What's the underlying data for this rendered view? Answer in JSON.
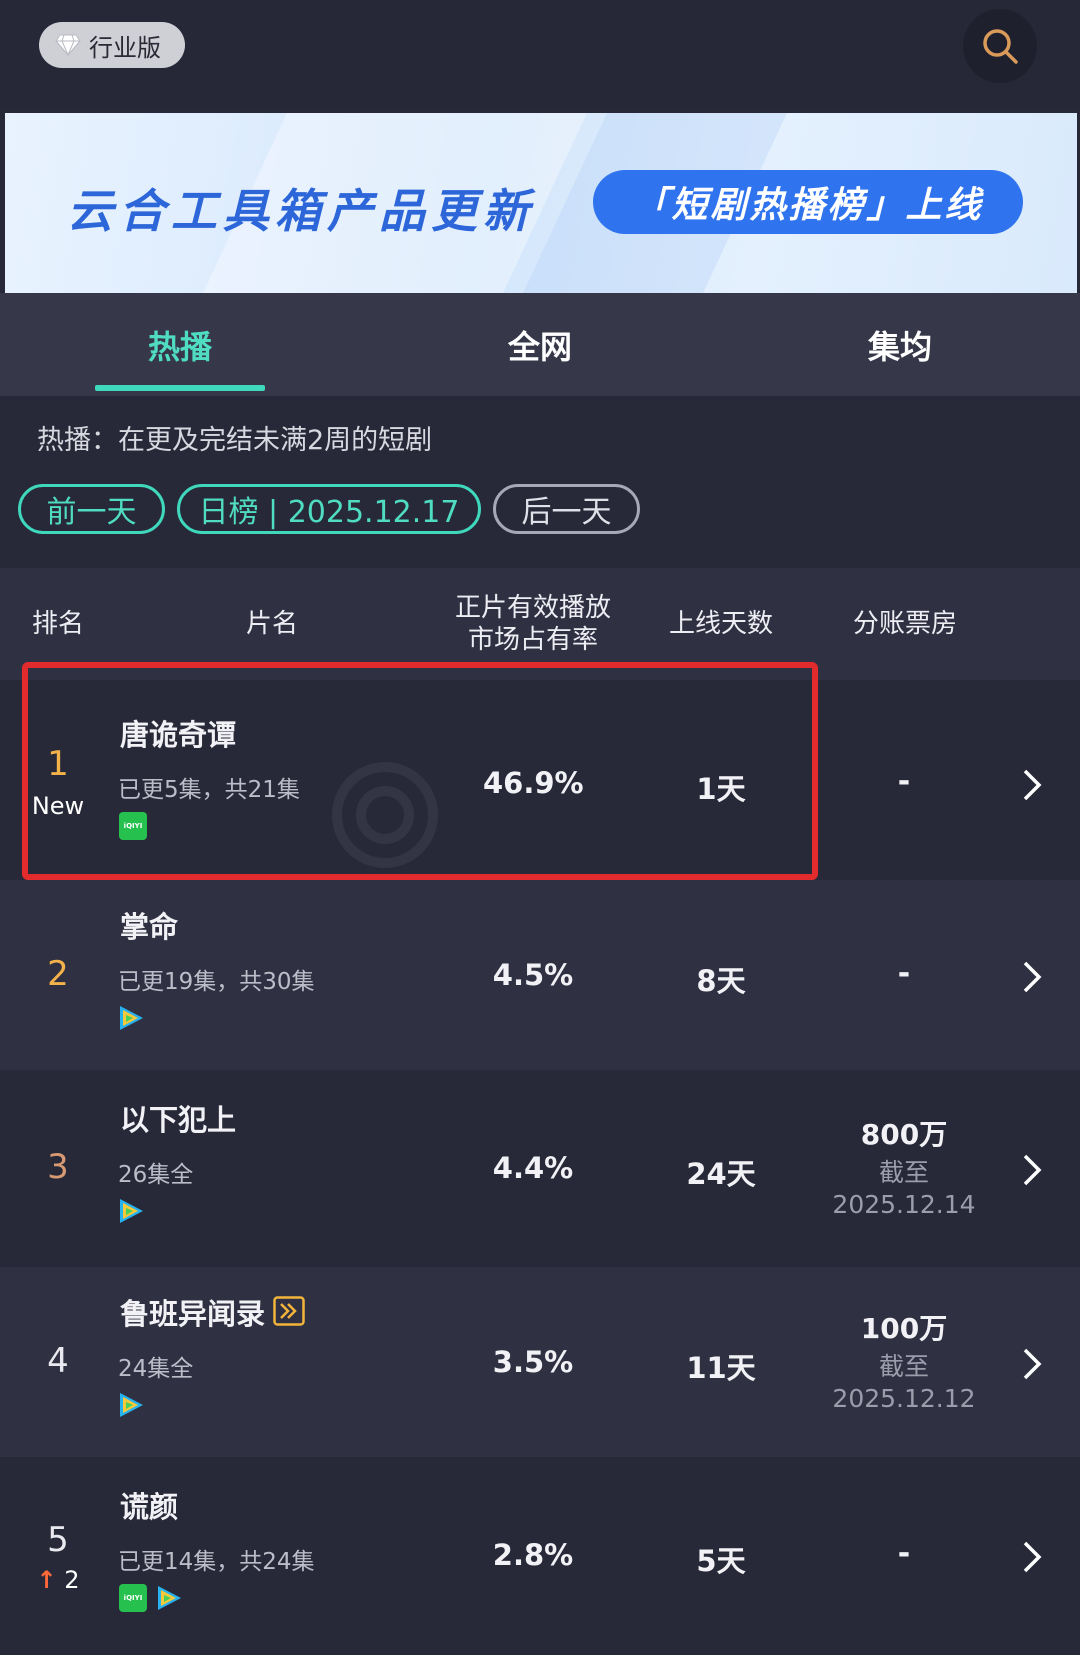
{
  "header": {
    "badge_label": "行业版",
    "search_icon": "search-icon"
  },
  "banner": {
    "title": "云合工具箱产品更新",
    "pill": "「短剧热播榜」上线"
  },
  "tabs": [
    {
      "label": "热播",
      "active": true
    },
    {
      "label": "全网",
      "active": false
    },
    {
      "label": "集均",
      "active": false
    }
  ],
  "description": "热播：在更及完结未满2周的短剧",
  "date_nav": {
    "prev": "前一天",
    "current": "日榜 | 2025.12.17",
    "next": "后一天"
  },
  "table": {
    "headers": {
      "rank": "排名",
      "title": "片名",
      "share_line1": "正片有效播放",
      "share_line2": "市场占有率",
      "days": "上线天数",
      "box": "分账票房"
    },
    "rows": [
      {
        "rank": "1",
        "rank_sub": "New",
        "title": "唐诡奇谭",
        "episodes": "已更5集，共21集",
        "platforms": [
          "iqiyi"
        ],
        "share": "46.9%",
        "days": "1天",
        "box": "-",
        "box_note": "",
        "box_date": "",
        "highlighted": true
      },
      {
        "rank": "2",
        "rank_sub": "",
        "title": "掌命",
        "episodes": "已更19集，共30集",
        "platforms": [
          "tencent"
        ],
        "share": "4.5%",
        "days": "8天",
        "box": "-",
        "box_note": "",
        "box_date": ""
      },
      {
        "rank": "3",
        "rank_sub": "",
        "title": "以下犯上",
        "episodes": "26集全",
        "platforms": [
          "tencent"
        ],
        "share": "4.4%",
        "days": "24天",
        "box": "800万",
        "box_note": "截至",
        "box_date": "2025.12.14"
      },
      {
        "rank": "4",
        "rank_sub": "",
        "title": "鲁班异闻录",
        "episodes": "24集全",
        "platforms": [
          "tencent"
        ],
        "share": "3.5%",
        "days": "11天",
        "box": "100万",
        "box_note": "截至",
        "box_date": "2025.12.12",
        "title_badge": "fast-forward-icon"
      },
      {
        "rank": "5",
        "rank_sub_arrow": "↑",
        "rank_sub": "2",
        "title": "谎颜",
        "episodes": "已更14集，共24集",
        "platforms": [
          "iqiyi",
          "tencent"
        ],
        "share": "2.8%",
        "days": "5天",
        "box": "-",
        "box_note": "",
        "box_date": ""
      }
    ]
  },
  "platform_logos": {
    "iqiyi_text": "iQIYI"
  },
  "colors": {
    "accent": "#3fd8bd",
    "background": "#272838",
    "highlight_box": "#e32a2c",
    "rank_gold": "#f3b24a",
    "rank_up": "#ff6a3a"
  }
}
